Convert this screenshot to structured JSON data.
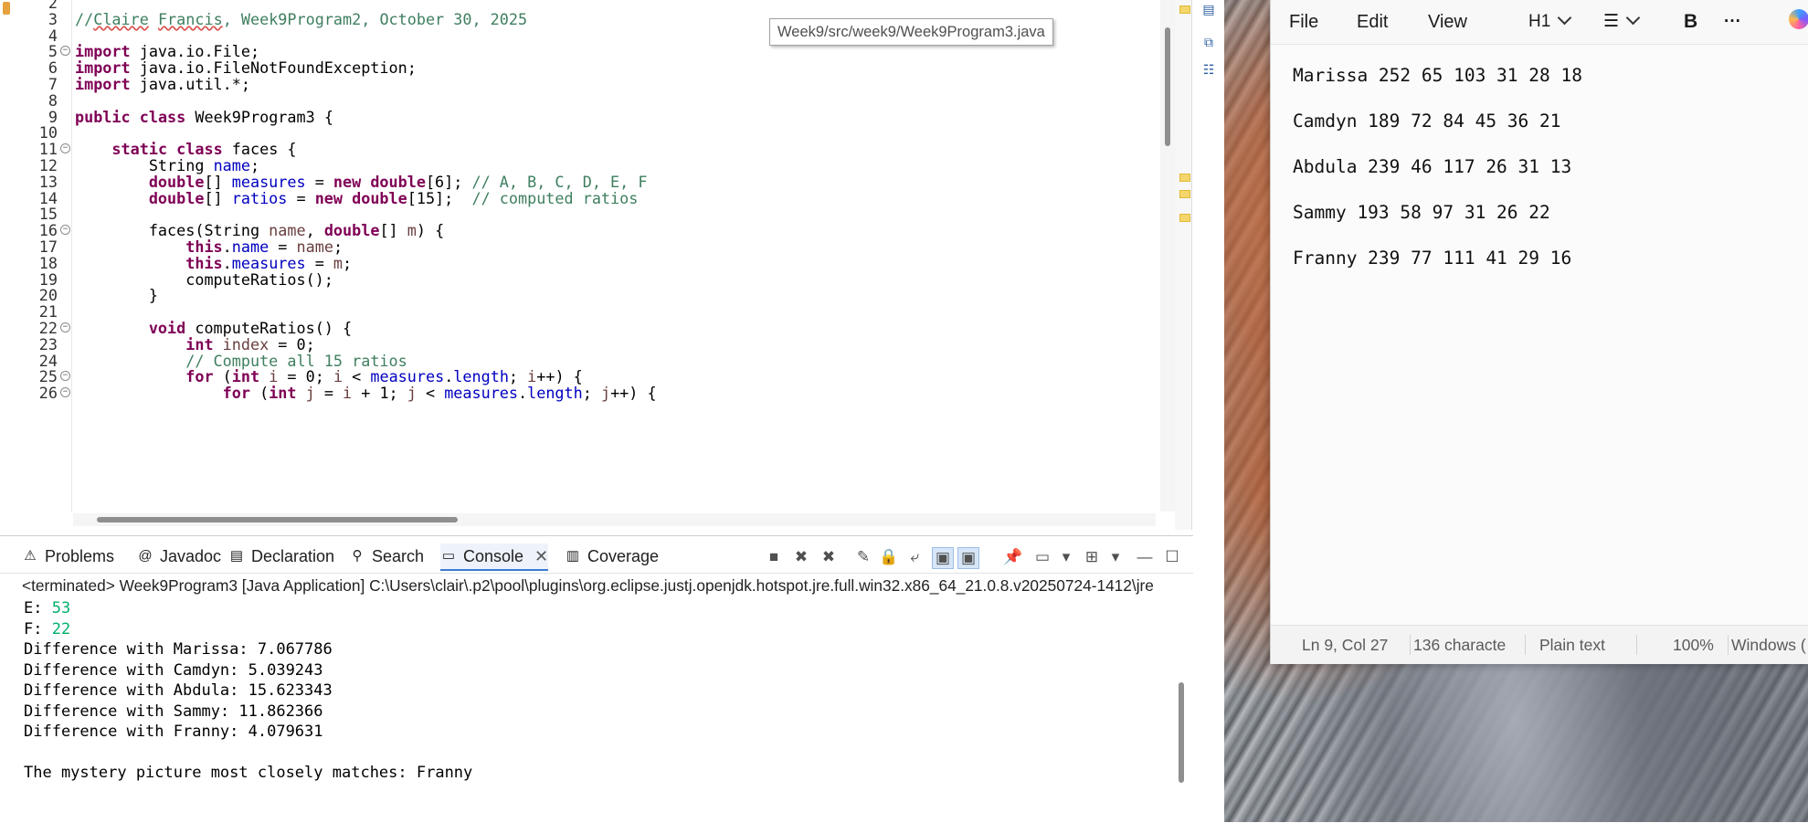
{
  "editor": {
    "tooltip": "Week9/src/week9/Week9Program3.java",
    "lines": [
      {
        "n": "2",
        "fold": false,
        "segs": []
      },
      {
        "n": "3",
        "fold": false,
        "segs": [
          {
            "t": "//",
            "c": "cmt"
          },
          {
            "t": "Claire",
            "c": "cmt ul"
          },
          {
            "t": " ",
            "c": "cmt"
          },
          {
            "t": "Francis",
            "c": "cmt ul"
          },
          {
            "t": ", Week9Program2, October 30, 2025",
            "c": "cmt"
          }
        ]
      },
      {
        "n": "4",
        "fold": false,
        "segs": []
      },
      {
        "n": "5",
        "fold": true,
        "segs": [
          {
            "t": "import",
            "c": "kw"
          },
          {
            "t": " java.io.File;",
            "c": ""
          }
        ]
      },
      {
        "n": "6",
        "fold": false,
        "segs": [
          {
            "t": "import",
            "c": "kw"
          },
          {
            "t": " java.io.FileNotFoundException;",
            "c": ""
          }
        ]
      },
      {
        "n": "7",
        "fold": false,
        "segs": [
          {
            "t": "import",
            "c": "kw"
          },
          {
            "t": " java.util.*;",
            "c": ""
          }
        ]
      },
      {
        "n": "8",
        "fold": false,
        "segs": []
      },
      {
        "n": "9",
        "fold": false,
        "segs": [
          {
            "t": "public",
            "c": "kw"
          },
          {
            "t": " ",
            "c": ""
          },
          {
            "t": "class",
            "c": "kw"
          },
          {
            "t": " Week9Program3 {",
            "c": ""
          }
        ]
      },
      {
        "n": "10",
        "fold": false,
        "segs": []
      },
      {
        "n": "11",
        "fold": true,
        "segs": [
          {
            "t": "    ",
            "c": ""
          },
          {
            "t": "static",
            "c": "kw"
          },
          {
            "t": " ",
            "c": ""
          },
          {
            "t": "class",
            "c": "kw"
          },
          {
            "t": " faces {",
            "c": ""
          }
        ]
      },
      {
        "n": "12",
        "fold": false,
        "segs": [
          {
            "t": "        String ",
            "c": ""
          },
          {
            "t": "name",
            "c": "fld"
          },
          {
            "t": ";",
            "c": ""
          }
        ]
      },
      {
        "n": "13",
        "fold": false,
        "segs": [
          {
            "t": "        ",
            "c": ""
          },
          {
            "t": "double",
            "c": "kw"
          },
          {
            "t": "[] ",
            "c": ""
          },
          {
            "t": "measures",
            "c": "fld"
          },
          {
            "t": " = ",
            "c": ""
          },
          {
            "t": "new",
            "c": "kw"
          },
          {
            "t": " ",
            "c": ""
          },
          {
            "t": "double",
            "c": "kw"
          },
          {
            "t": "[6]; ",
            "c": ""
          },
          {
            "t": "// A, B, C, D, E, F",
            "c": "cmt"
          }
        ]
      },
      {
        "n": "14",
        "fold": false,
        "segs": [
          {
            "t": "        ",
            "c": ""
          },
          {
            "t": "double",
            "c": "kw"
          },
          {
            "t": "[] ",
            "c": ""
          },
          {
            "t": "ratios",
            "c": "fld"
          },
          {
            "t": " = ",
            "c": ""
          },
          {
            "t": "new",
            "c": "kw"
          },
          {
            "t": " ",
            "c": ""
          },
          {
            "t": "double",
            "c": "kw"
          },
          {
            "t": "[15];  ",
            "c": ""
          },
          {
            "t": "// computed ratios",
            "c": "cmt"
          }
        ]
      },
      {
        "n": "15",
        "fold": false,
        "segs": []
      },
      {
        "n": "16",
        "fold": true,
        "segs": [
          {
            "t": "        faces(String ",
            "c": ""
          },
          {
            "t": "name",
            "c": "par"
          },
          {
            "t": ", ",
            "c": ""
          },
          {
            "t": "double",
            "c": "kw"
          },
          {
            "t": "[] ",
            "c": ""
          },
          {
            "t": "m",
            "c": "par"
          },
          {
            "t": ") {",
            "c": ""
          }
        ]
      },
      {
        "n": "17",
        "fold": false,
        "segs": [
          {
            "t": "            ",
            "c": ""
          },
          {
            "t": "this",
            "c": "kw"
          },
          {
            "t": ".",
            "c": ""
          },
          {
            "t": "name",
            "c": "fld"
          },
          {
            "t": " = ",
            "c": ""
          },
          {
            "t": "name",
            "c": "par"
          },
          {
            "t": ";",
            "c": ""
          }
        ]
      },
      {
        "n": "18",
        "fold": false,
        "segs": [
          {
            "t": "            ",
            "c": ""
          },
          {
            "t": "this",
            "c": "kw"
          },
          {
            "t": ".",
            "c": ""
          },
          {
            "t": "measures",
            "c": "fld"
          },
          {
            "t": " = ",
            "c": ""
          },
          {
            "t": "m",
            "c": "par"
          },
          {
            "t": ";",
            "c": ""
          }
        ]
      },
      {
        "n": "19",
        "fold": false,
        "segs": [
          {
            "t": "            computeRatios();",
            "c": ""
          }
        ]
      },
      {
        "n": "20",
        "fold": false,
        "segs": [
          {
            "t": "        }",
            "c": ""
          }
        ]
      },
      {
        "n": "21",
        "fold": false,
        "segs": []
      },
      {
        "n": "22",
        "fold": true,
        "segs": [
          {
            "t": "        ",
            "c": ""
          },
          {
            "t": "void",
            "c": "kw"
          },
          {
            "t": " computeRatios() {",
            "c": ""
          }
        ]
      },
      {
        "n": "23",
        "fold": false,
        "segs": [
          {
            "t": "            ",
            "c": ""
          },
          {
            "t": "int",
            "c": "kw"
          },
          {
            "t": " ",
            "c": ""
          },
          {
            "t": "index",
            "c": "var"
          },
          {
            "t": " = 0;",
            "c": ""
          }
        ]
      },
      {
        "n": "24",
        "fold": false,
        "segs": [
          {
            "t": "            ",
            "c": ""
          },
          {
            "t": "// Compute all 15 ratios",
            "c": "cmt"
          }
        ]
      },
      {
        "n": "25",
        "fold": true,
        "segs": [
          {
            "t": "            ",
            "c": ""
          },
          {
            "t": "for",
            "c": "kw"
          },
          {
            "t": " (",
            "c": ""
          },
          {
            "t": "int",
            "c": "kw"
          },
          {
            "t": " ",
            "c": ""
          },
          {
            "t": "i",
            "c": "var"
          },
          {
            "t": " = 0; ",
            "c": ""
          },
          {
            "t": "i",
            "c": "var"
          },
          {
            "t": " < ",
            "c": ""
          },
          {
            "t": "measures",
            "c": "fld"
          },
          {
            "t": ".",
            "c": ""
          },
          {
            "t": "length",
            "c": "fld"
          },
          {
            "t": "; ",
            "c": ""
          },
          {
            "t": "i",
            "c": "var"
          },
          {
            "t": "++) {",
            "c": ""
          }
        ]
      },
      {
        "n": "26",
        "fold": true,
        "segs": [
          {
            "t": "                ",
            "c": ""
          },
          {
            "t": "for",
            "c": "kw"
          },
          {
            "t": " (",
            "c": ""
          },
          {
            "t": "int",
            "c": "kw"
          },
          {
            "t": " ",
            "c": ""
          },
          {
            "t": "j",
            "c": "var"
          },
          {
            "t": " = ",
            "c": ""
          },
          {
            "t": "i",
            "c": "var"
          },
          {
            "t": " + 1; ",
            "c": ""
          },
          {
            "t": "j",
            "c": "var"
          },
          {
            "t": " < ",
            "c": ""
          },
          {
            "t": "measures",
            "c": "fld"
          },
          {
            "t": ".",
            "c": ""
          },
          {
            "t": "length",
            "c": "fld"
          },
          {
            "t": "; ",
            "c": ""
          },
          {
            "t": "j",
            "c": "var"
          },
          {
            "t": "++) {",
            "c": ""
          }
        ]
      }
    ]
  },
  "console_panel": {
    "tabs": [
      {
        "label": "Problems",
        "icon": "problems-icon",
        "glyph": "⚠",
        "active": false
      },
      {
        "label": "Javadoc",
        "icon": "javadoc-icon",
        "glyph": "@",
        "active": false
      },
      {
        "label": "Declaration",
        "icon": "declaration-icon",
        "glyph": "▤",
        "active": false
      },
      {
        "label": "Search",
        "icon": "search-icon",
        "glyph": "⚲",
        "active": false
      },
      {
        "label": "Console",
        "icon": "console-icon",
        "glyph": "▭",
        "active": true
      },
      {
        "label": "Coverage",
        "icon": "coverage-icon",
        "glyph": "▥",
        "active": false
      }
    ],
    "terminated": "<terminated> Week9Program3 [Java Application] C:\\Users\\clair\\.p2\\pool\\plugins\\org.eclipse.justj.openjdk.hotspot.jre.full.win32.x86_64_21.0.8.v20250724-1412\\jre",
    "output": [
      {
        "label": "E: ",
        "input": "53"
      },
      {
        "label": "F: ",
        "input": "22"
      },
      {
        "label": "Difference with Marissa: 7.067786",
        "input": ""
      },
      {
        "label": "Difference with Camdyn: 5.039243",
        "input": ""
      },
      {
        "label": "Difference with Abdula: 15.623343",
        "input": ""
      },
      {
        "label": "Difference with Sammy: 11.862366",
        "input": ""
      },
      {
        "label": "Difference with Franny: 4.079631",
        "input": ""
      },
      {
        "label": "",
        "input": ""
      },
      {
        "label": "The mystery picture most closely matches: Franny",
        "input": ""
      }
    ]
  },
  "notepad": {
    "menu": {
      "file": "File",
      "edit": "Edit",
      "view": "View"
    },
    "heading": "H1",
    "bold": "B",
    "more": "···",
    "lines": [
      "Marissa 252 65 103 31 28 18",
      "Camdyn 189 72 84 45 36 21",
      "Abdula 239 46 117 26 31 13",
      "Sammy 193 58 97 31 26 22",
      "Franny 239 77 111 41 29 16"
    ],
    "status": {
      "position": "Ln 9, Col 27",
      "chars": "136 characte",
      "format": "Plain text",
      "zoom": "100%",
      "eol": "Windows ("
    }
  },
  "colors": {
    "keyword": "#7f0055",
    "field": "#0000c0",
    "comment": "#3f7f5f",
    "console_input": "#00b06a",
    "active_tab": "#3b7bd4"
  }
}
